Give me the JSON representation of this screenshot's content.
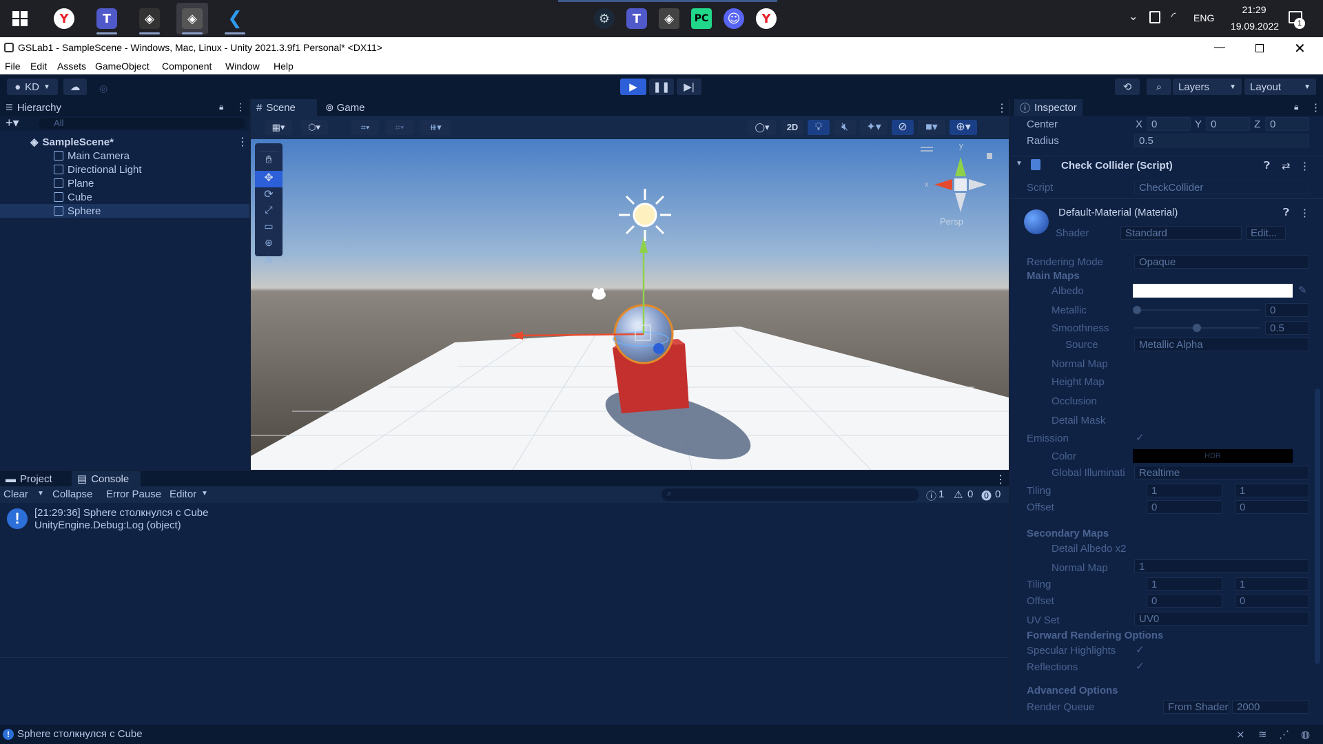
{
  "taskbar": {
    "apps": [
      "yandex-browser",
      "teams",
      "unity-hub",
      "unity-editor",
      "vscode"
    ],
    "pinned": [
      "steam",
      "teams",
      "unity",
      "pycharm",
      "discord",
      "yandex"
    ],
    "language": "ENG",
    "time": "21:29",
    "date": "19.09.2022",
    "notification_count": "1"
  },
  "window": {
    "title": "GSLab1 - SampleScene - Windows, Mac, Linux - Unity 2021.3.9f1 Personal* <DX11>"
  },
  "menu": [
    "File",
    "Edit",
    "Assets",
    "GameObject",
    "Component",
    "Window",
    "Help"
  ],
  "toolbar": {
    "account": "KD",
    "layers": "Layers",
    "layout": "Layout"
  },
  "hierarchy": {
    "tab": "Hierarchy",
    "search_placeholder": "All",
    "scene": "SampleScene*",
    "items": [
      "Main Camera",
      "Directional Light",
      "Plane",
      "Cube",
      "Sphere"
    ]
  },
  "scene_tabs": {
    "scene": "Scene",
    "game": "Game",
    "btn_2d": "2D",
    "persp": "Persp"
  },
  "inspector": {
    "tab": "Inspector",
    "center_label": "Center",
    "center": {
      "x": "0",
      "y": "0",
      "z": "0"
    },
    "radius_label": "Radius",
    "radius": "0.5",
    "component": "Check Collider (Script)",
    "script_label": "Script",
    "script_value": "CheckCollider",
    "material": "Default-Material (Material)",
    "shader_label": "Shader",
    "shader_value": "Standard",
    "edit_label": "Edit...",
    "rendering_mode_label": "Rendering Mode",
    "rendering_mode": "Opaque",
    "main_maps": "Main Maps",
    "albedo": "Albedo",
    "metallic": "Metallic",
    "metallic_value": "0",
    "smoothness": "Smoothness",
    "smoothness_value": "0.5",
    "source": "Source",
    "source_value": "Metallic Alpha",
    "normal_map": "Normal Map",
    "height_map": "Height Map",
    "occlusion": "Occlusion",
    "detail_mask": "Detail Mask",
    "emission": "Emission",
    "color": "Color",
    "hdr": "HDR",
    "global_illum": "Global Illuminati",
    "global_illum_value": "Realtime",
    "tiling": "Tiling",
    "offset": "Offset",
    "tiling_x": "1",
    "tiling_y": "1",
    "offset_x": "0",
    "offset_y": "0",
    "secondary_maps": "Secondary Maps",
    "detail_albedo": "Detail Albedo x2",
    "sec_normal_map": "Normal Map",
    "sec_normal_value": "1",
    "sec_tiling_x": "1",
    "sec_tiling_y": "1",
    "sec_offset_x": "0",
    "sec_offset_y": "0",
    "uv_set": "UV Set",
    "uv_set_value": "UV0",
    "forward": "Forward Rendering Options",
    "specular": "Specular Highlights",
    "reflections": "Reflections",
    "advanced": "Advanced Options",
    "render_queue": "Render Queue",
    "render_queue_mode": "From Shader",
    "render_queue_value": "2000"
  },
  "console": {
    "tab_project": "Project",
    "tab_console": "Console",
    "clear": "Clear",
    "collapse": "Collapse",
    "error_pause": "Error Pause",
    "editor": "Editor",
    "log_count": "1",
    "warn_count": "0",
    "error_count": "0",
    "entries": [
      {
        "line1": "[21:29:36] Sphere столкнулся с Cube",
        "line2": "UnityEngine.Debug:Log (object)"
      }
    ]
  },
  "status": {
    "message": "Sphere столкнулся с Cube"
  }
}
